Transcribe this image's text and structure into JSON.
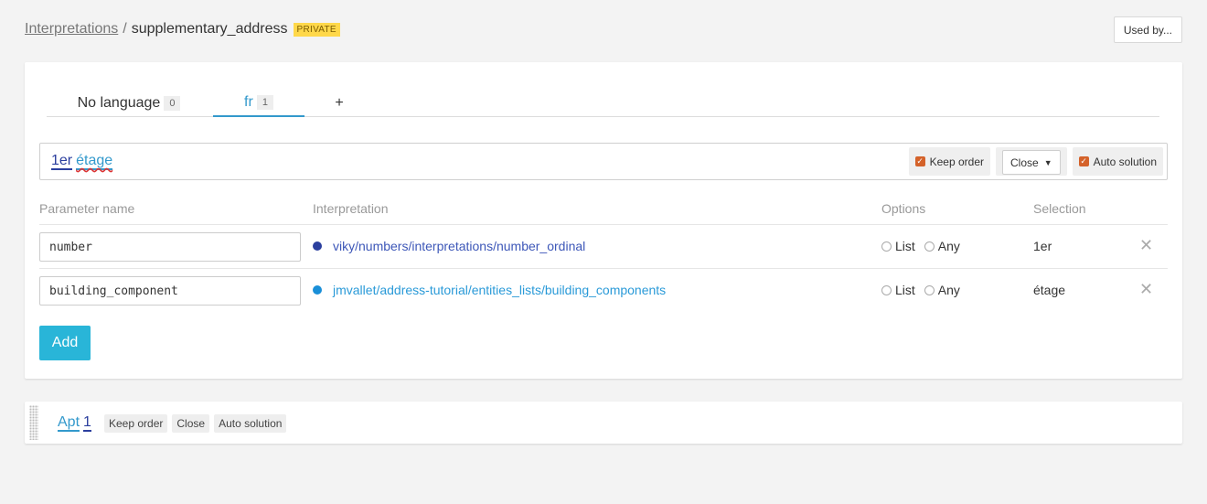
{
  "header": {
    "breadcrumb_link": "Interpretations",
    "separator": "/",
    "title": "supplementary_address",
    "badge": "PRIVATE",
    "used_by_label": "Used by..."
  },
  "tabs": [
    {
      "label": "No language",
      "count": "0",
      "active": false
    },
    {
      "label": "fr",
      "count": "1",
      "active": true
    },
    {
      "label": "+",
      "active": false
    }
  ],
  "sentence": {
    "words": [
      "1er",
      "étage"
    ],
    "keep_order_label": "Keep order",
    "close_select_value": "Close",
    "auto_solution_label": "Auto solution"
  },
  "table": {
    "headers": {
      "parameter_name": "Parameter name",
      "interpretation": "Interpretation",
      "options": "Options",
      "selection": "Selection"
    },
    "rows": [
      {
        "parameter": "number",
        "interpretation": "viky/numbers/interpretations/number_ordinal",
        "dot_color": "#2b3f9e",
        "option_list": "List",
        "option_any": "Any",
        "selection": "1er"
      },
      {
        "parameter": "building_component",
        "interpretation": "jmvallet/address-tutorial/entities_lists/building_components",
        "dot_color": "#1a8fd8",
        "option_list": "List",
        "option_any": "Any",
        "selection": "étage"
      }
    ]
  },
  "add_label": "Add",
  "second_sentence": {
    "words": [
      "Apt",
      "1"
    ],
    "tags": [
      "Keep order",
      "Close",
      "Auto solution"
    ]
  },
  "icons": {
    "remove": "close-icon",
    "checkbox": "check-icon",
    "select_arrow": "chevron-down-icon"
  },
  "colors": {
    "accent": "#3399cc",
    "add_button": "#29b5d8",
    "checkbox": "#d4622a",
    "private_badge": "#ffd84a"
  }
}
